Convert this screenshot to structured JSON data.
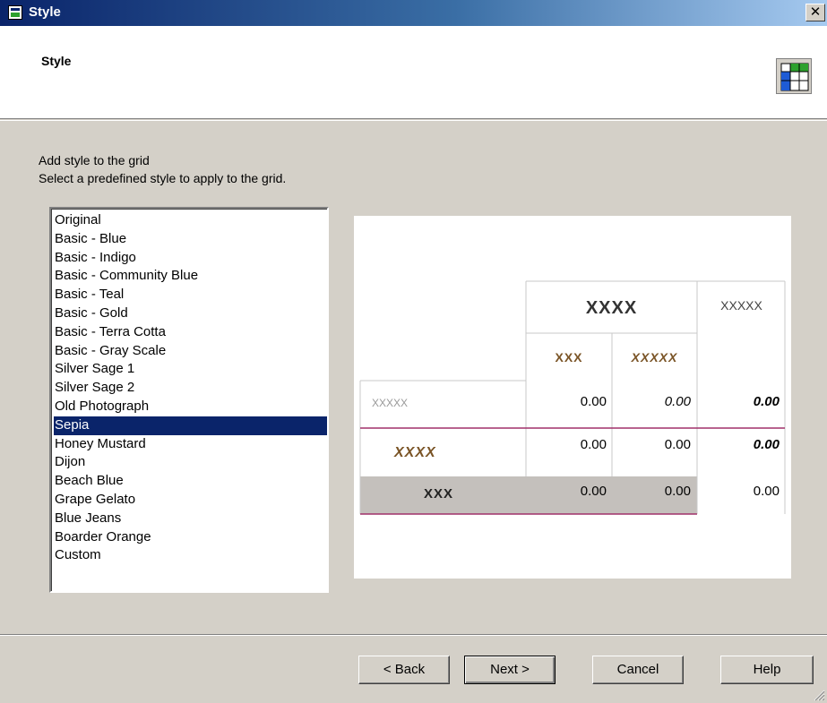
{
  "window": {
    "title": "Style",
    "close_glyph": "✕"
  },
  "header": {
    "title": "Style",
    "icon": "grid-style-icon"
  },
  "instructions": {
    "line1": "Add style to the grid",
    "line2": "Select a predefined style to apply to the grid."
  },
  "styles": {
    "items": [
      "Original",
      "Basic - Blue",
      "Basic - Indigo",
      "Basic - Community Blue",
      "Basic - Teal",
      "Basic - Gold",
      "Basic - Terra Cotta",
      "Basic - Gray Scale",
      "Silver Sage 1",
      "Silver Sage 2",
      "Old Photograph",
      "Sepia",
      "Honey Mustard",
      "Dijon",
      "Beach Blue",
      "Grape Gelato",
      "Blue Jeans",
      "Boarder Orange",
      "Custom"
    ],
    "selected": "Sepia"
  },
  "preview": {
    "col_header": "XXXX",
    "row_header_top": "XXXXX",
    "sub_header_1": "XXX",
    "sub_header_2": "XXXXX",
    "row1_label": "XXXXX",
    "row2_label": "XXXX",
    "row3_label": "XXX",
    "row1_values": [
      "0.00",
      "0.00",
      "0.00"
    ],
    "row2_values": [
      "0.00",
      "0.00",
      "0.00"
    ],
    "row3_values": [
      "0.00",
      "0.00",
      "0.00"
    ],
    "colors": {
      "accent_brown": "#7a5426",
      "accent_line": "#a0306a",
      "shaded_row": "#c4c0bc",
      "grid_line": "#c8c8c8"
    }
  },
  "buttons": {
    "back": "< Back",
    "next": "Next >",
    "cancel": "Cancel",
    "help": "Help"
  }
}
